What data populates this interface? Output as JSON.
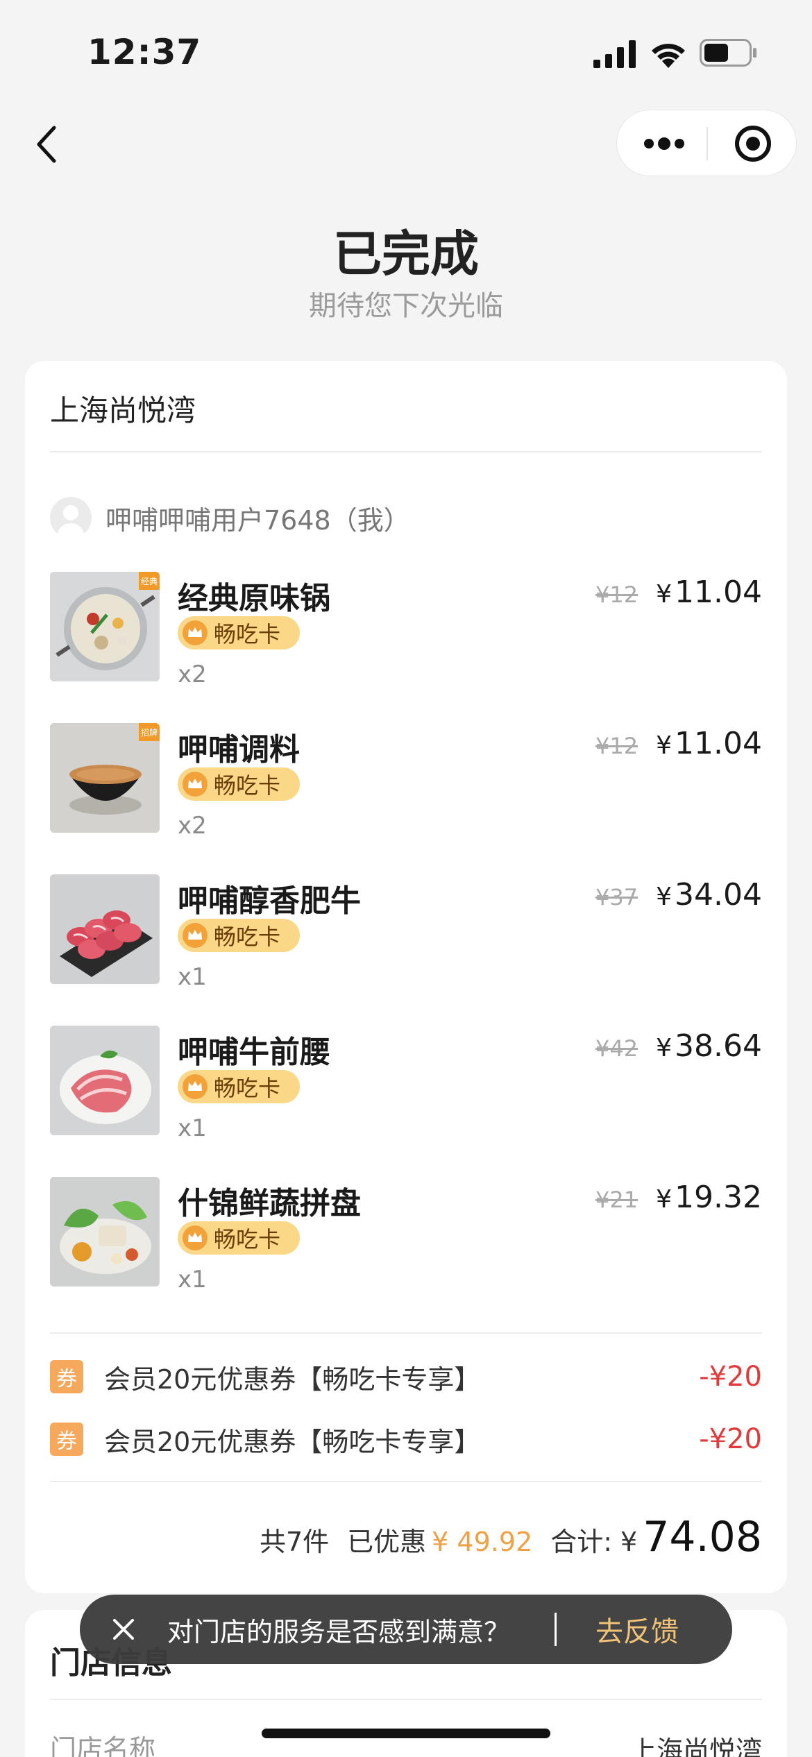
{
  "status_bar": {
    "time": "12:37"
  },
  "header": {
    "title": "已完成",
    "subtitle": "期待您下次光临"
  },
  "order": {
    "store_name": "上海尚悦湾",
    "user": "呷哺呷哺用户7648（我）",
    "badge_label": "畅吃卡",
    "items": [
      {
        "name": "经典原味锅",
        "original_price": "¥12",
        "price": "11.04",
        "qty": "x2",
        "tag": "经典",
        "icon": "hotpot-pot-image"
      },
      {
        "name": "呷哺调料",
        "original_price": "¥12",
        "price": "11.04",
        "qty": "x2",
        "tag": "招牌",
        "icon": "sauce-bowl-image"
      },
      {
        "name": "呷哺醇香肥牛",
        "original_price": "¥37",
        "price": "34.04",
        "qty": "x1",
        "icon": "beef-roll-image"
      },
      {
        "name": "呷哺牛前腰",
        "original_price": "¥42",
        "price": "38.64",
        "qty": "x1",
        "icon": "beef-slices-image"
      },
      {
        "name": "什锦鲜蔬拼盘",
        "original_price": "¥21",
        "price": "19.32",
        "qty": "x1",
        "icon": "vegetable-platter-image"
      }
    ],
    "coupons": [
      {
        "tag": "券",
        "name": "会员20元优惠券【畅吃卡专享】",
        "amount": "-¥20"
      },
      {
        "tag": "券",
        "name": "会员20元优惠券【畅吃卡专享】",
        "amount": "-¥20"
      }
    ],
    "summary": {
      "count": "共7件",
      "saved_label": "已优惠",
      "saved": "¥ 49.92",
      "total_label": "合计:",
      "currency": "¥",
      "total": "74.08"
    }
  },
  "store_info": {
    "title": "门店信息",
    "name_label": "门店名称",
    "name_value": "上海尚悦湾"
  },
  "toast": {
    "message": "对门店的服务是否感到满意？",
    "action": "去反馈"
  },
  "colors": {
    "badge": "#fbd888",
    "coupon_tag": "#f6a95c",
    "discount": "#e23b3b",
    "saved": "#f0a045",
    "toast_action": "#f2c377"
  }
}
